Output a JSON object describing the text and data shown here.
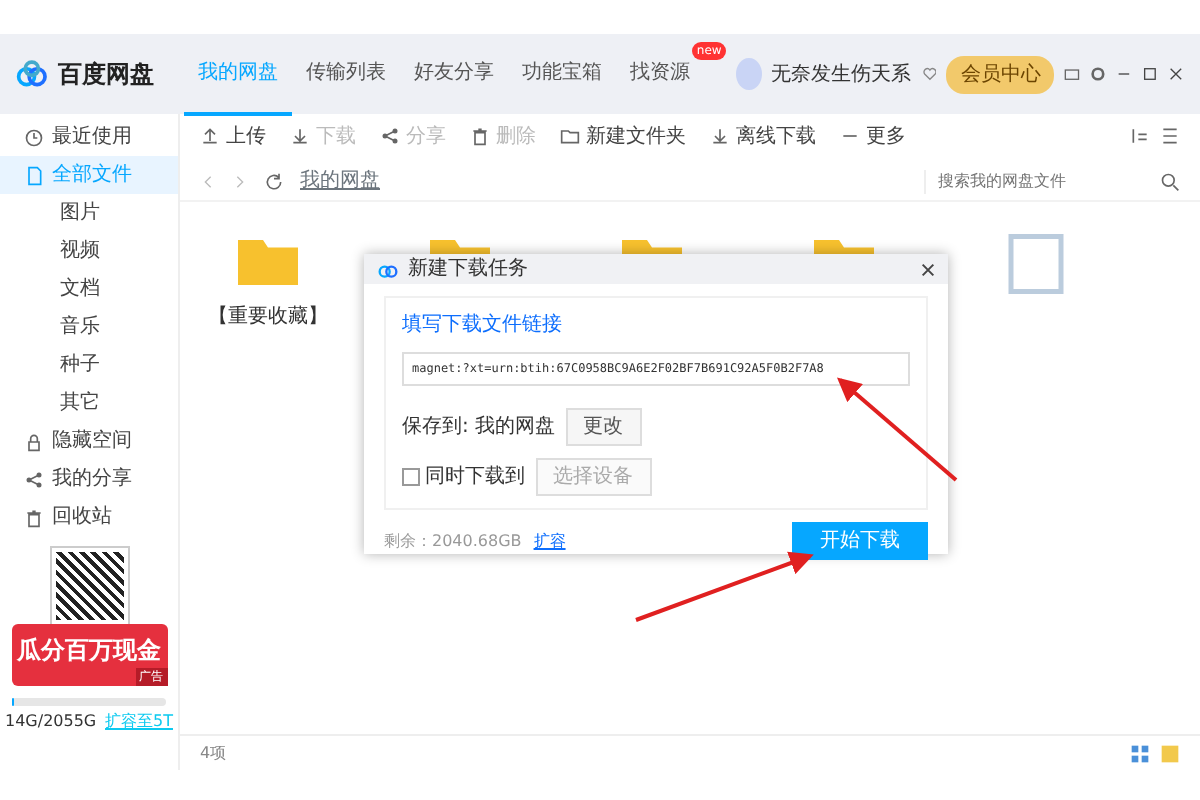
{
  "app": {
    "name": "百度网盘"
  },
  "tabs": [
    {
      "label": "我的网盘",
      "selected": true
    },
    {
      "label": "传输列表",
      "selected": false
    },
    {
      "label": "好友分享",
      "selected": false
    },
    {
      "label": "功能宝箱",
      "selected": false
    },
    {
      "label": "找资源",
      "selected": false,
      "badge": "new"
    }
  ],
  "user": {
    "name": "无奈发生伤天系",
    "vip_label": "会员中心"
  },
  "toolbar": [
    {
      "label": "上传",
      "disabled": false
    },
    {
      "label": "下载",
      "disabled": true
    },
    {
      "label": "分享",
      "disabled": true
    },
    {
      "label": "删除",
      "disabled": true
    },
    {
      "label": "新建文件夹",
      "disabled": false
    },
    {
      "label": "离线下载",
      "disabled": false
    },
    {
      "label": "更多",
      "disabled": false
    }
  ],
  "sidebar": {
    "items": [
      {
        "label": "最近使用",
        "selected": false
      },
      {
        "label": "全部文件",
        "selected": true,
        "children": [
          {
            "label": "图片",
            "selected": false
          },
          {
            "label": "视频",
            "selected": false
          },
          {
            "label": "文档",
            "selected": false
          },
          {
            "label": "音乐",
            "selected": false
          },
          {
            "label": "种子",
            "selected": false
          },
          {
            "label": "其它",
            "selected": false
          }
        ]
      },
      {
        "label": "隐藏空间",
        "selected": false
      },
      {
        "label": "我的分享",
        "selected": false
      },
      {
        "label": "回收站",
        "selected": false
      }
    ],
    "ad": {
      "headline": "瓜分百万现金",
      "tag": "广告"
    },
    "storage": {
      "level": 0.01,
      "used": "14G/2055G",
      "upgrade_link": "扩容至5T"
    }
  },
  "breadcrumb": [
    "我的网盘"
  ],
  "search": {
    "placeholder": "搜索我的网盘文件"
  },
  "folders": [
    {
      "kind": "folder",
      "name": "【重要收藏】"
    },
    {
      "kind": "folder"
    },
    {
      "kind": "folder"
    },
    {
      "kind": "folder"
    },
    {
      "kind": "file"
    }
  ],
  "dialog": {
    "title": "新建下载任务",
    "link_label": "填写下载文件链接",
    "link_value": "magnet:?xt=urn:btih:67C0958BC9A6E2F02BF7B691C92A5F0B2F7A8",
    "save_label": "保存到: 我的网盘",
    "change_button": "更改",
    "also_download": {
      "label": "同时下载到",
      "checked": false
    },
    "device_button": "选择设备",
    "remaining": "剩余：2040.68GB",
    "expand_link": "扩容",
    "start_button": "开始下载"
  },
  "status_bar": {
    "count": "4项"
  }
}
